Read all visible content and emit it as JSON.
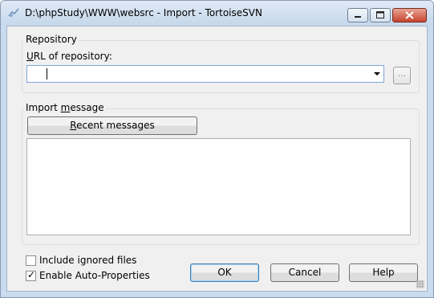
{
  "window": {
    "title": "D:\\phpStudy\\WWW\\websrc - Import - TortoiseSVN",
    "minimize_icon": "minimize-icon",
    "maximize_icon": "maximize-icon",
    "close_icon": "close-icon"
  },
  "repository": {
    "group_label": "Repository",
    "url_label_underlined": "U",
    "url_label_rest": "RL of repository:",
    "url_value": "",
    "browse_label": "..."
  },
  "import_message": {
    "group_label_pre": "Import ",
    "group_label_underlined": "m",
    "group_label_post": "essage",
    "recent_pre": "",
    "recent_underlined": "R",
    "recent_post": "ecent messages",
    "message_text": ""
  },
  "options": {
    "include_ignored_label": "Include ignored files",
    "include_ignored_checked": false,
    "auto_props_label": "Enable Auto-Properties",
    "auto_props_checked": true
  },
  "buttons": {
    "ok": "OK",
    "cancel": "Cancel",
    "help": "Help"
  }
}
